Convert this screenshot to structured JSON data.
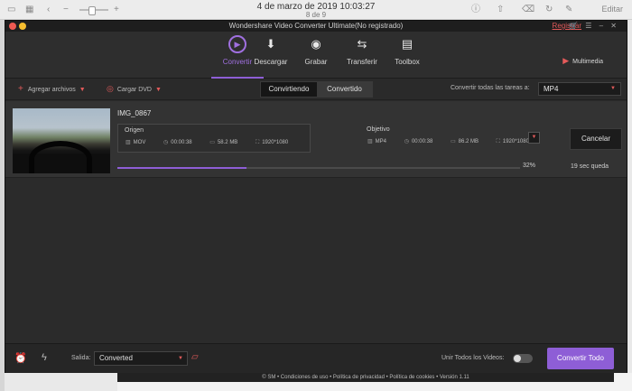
{
  "viewer": {
    "title": "4 de marzo de 2019 10:03:27",
    "subtitle": "8 de 9",
    "edit_label": "Editar"
  },
  "app": {
    "title": "Wondershare Video Converter Ultimate(No registrado)",
    "register_link": "Registrar",
    "accent_color": "#8e5ed6",
    "nav_tabs": [
      {
        "label": "Convertir",
        "icon": "convert-icon",
        "active": true
      },
      {
        "label": "Descargar",
        "icon": "download-icon",
        "active": false
      },
      {
        "label": "Grabar",
        "icon": "burn-disc-icon",
        "active": false
      },
      {
        "label": "Transferir",
        "icon": "transfer-icon",
        "active": false
      },
      {
        "label": "Toolbox",
        "icon": "toolbox-icon",
        "active": false
      }
    ],
    "multimedia_label": "Multimedia"
  },
  "toolbar": {
    "add_files": "Agregar archivos",
    "load_dvd": "Cargar DVD",
    "segment_converting": "Convirtiendo",
    "segment_converted": "Convertido",
    "convert_all_to_label": "Convertir todas las tareas a:",
    "format_value": "MP4"
  },
  "task": {
    "filename": "IMG_0867",
    "origin": {
      "label": "Origen",
      "format": "MOV",
      "duration": "00:00:38",
      "size": "58.2 MB",
      "resolution": "1920*1080"
    },
    "objective": {
      "label": "Objetivo",
      "format": "MP4",
      "duration": "00:00:38",
      "size": "86.2 MB",
      "resolution": "1920*1080"
    },
    "progress_percent": 32,
    "progress_text": "32%",
    "cancel_label": "Cancelar",
    "remaining": "19 sec queda"
  },
  "bottom": {
    "output_label": "Salida:",
    "output_value": "Converted",
    "merge_label": "Unir Todos los Videos:",
    "merge_on": false,
    "convert_all_button": "Convertir Todo"
  },
  "footer": {
    "text": "© SM • Condiciones de uso • Política de privacidad • Política de cookies • Versión 1.11"
  }
}
